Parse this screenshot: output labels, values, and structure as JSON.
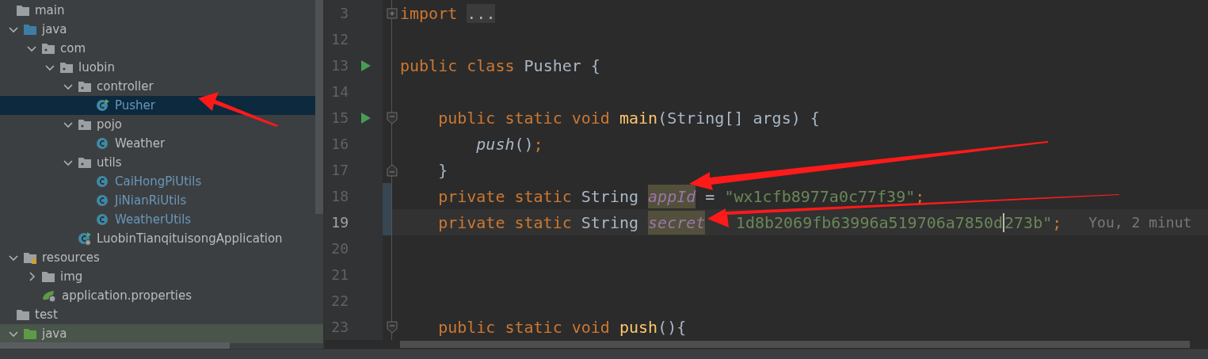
{
  "project_tree": [
    {
      "label": "main",
      "kind": "folder",
      "children": [
        {
          "label": "java",
          "kind": "source-folder",
          "expanded": true,
          "children": [
            {
              "label": "com",
              "kind": "package",
              "expanded": true,
              "children": [
                {
                  "label": "luobin",
                  "kind": "package",
                  "expanded": true,
                  "children": [
                    {
                      "label": "controller",
                      "kind": "package",
                      "expanded": true,
                      "children": [
                        {
                          "label": "Pusher",
                          "kind": "runnable-class",
                          "changed": true,
                          "selected": true
                        }
                      ]
                    },
                    {
                      "label": "pojo",
                      "kind": "package",
                      "expanded": true,
                      "children": [
                        {
                          "label": "Weather",
                          "kind": "class",
                          "changed": false,
                          "selected": false
                        }
                      ]
                    },
                    {
                      "label": "utils",
                      "kind": "package",
                      "expanded": true,
                      "children": [
                        {
                          "label": "CaiHongPiUtils",
                          "kind": "class",
                          "changed": true,
                          "selected": false
                        },
                        {
                          "label": "JiNianRiUtils",
                          "kind": "class",
                          "changed": true,
                          "selected": false
                        },
                        {
                          "label": "WeatherUtils",
                          "kind": "class",
                          "changed": true,
                          "selected": false
                        }
                      ]
                    },
                    {
                      "label": "LuobinTianqituisongApplication",
                      "kind": "spring-class",
                      "changed": false,
                      "selected": false
                    }
                  ]
                }
              ]
            }
          ]
        },
        {
          "label": "resources",
          "kind": "resources-folder",
          "expanded": true,
          "children": [
            {
              "label": "img",
              "kind": "folder",
              "expanded": false
            },
            {
              "label": "application.properties",
              "kind": "properties",
              "changed": false,
              "selected": false
            }
          ]
        }
      ]
    },
    {
      "label": "test",
      "kind": "folder",
      "children": [
        {
          "label": "java",
          "kind": "test-folder",
          "expanded": true
        }
      ]
    }
  ],
  "editor": {
    "lines": [
      {
        "number": "3",
        "current": false,
        "changed": false,
        "folded": true,
        "tokens": [
          {
            "text": "import ",
            "kind": "keyword"
          },
          {
            "text": "...",
            "kind": "folded"
          }
        ]
      },
      {
        "number": "12",
        "current": false,
        "changed": false
      },
      {
        "number": "13",
        "current": false,
        "changed": false,
        "run": true,
        "tokens": [
          {
            "text": "public class ",
            "kind": "keyword"
          },
          {
            "text": "Pusher {",
            "kind": "plain"
          }
        ]
      },
      {
        "number": "14",
        "current": false,
        "changed": false
      },
      {
        "number": "15",
        "current": false,
        "changed": false,
        "run": true,
        "fold_start": true,
        "tokens": [
          {
            "text": "    public static void ",
            "kind": "keyword"
          },
          {
            "text": "main",
            "kind": "method"
          },
          {
            "text": "(String[] args) {",
            "kind": "plain"
          }
        ]
      },
      {
        "number": "16",
        "current": false,
        "changed": false,
        "tokens": [
          {
            "text": "        push",
            "kind": "call"
          },
          {
            "text": "()",
            "kind": "plain"
          },
          {
            "text": ";",
            "kind": "keyword"
          }
        ]
      },
      {
        "number": "17",
        "current": false,
        "changed": false,
        "fold_end": true,
        "tokens": [
          {
            "text": "    }",
            "kind": "plain"
          }
        ]
      },
      {
        "number": "18",
        "current": false,
        "changed": true,
        "tokens": [
          {
            "text": "    private static ",
            "kind": "keyword"
          },
          {
            "text": "String ",
            "kind": "plain"
          },
          {
            "text": "appId",
            "kind": "field",
            "highlighted": true
          },
          {
            "text": " = ",
            "kind": "plain"
          },
          {
            "text": "\"wx1cfb8977a0c77f39\"",
            "kind": "string"
          },
          {
            "text": ";",
            "kind": "keyword"
          }
        ]
      },
      {
        "number": "19",
        "current": true,
        "changed": true,
        "tokens": [
          {
            "text": "    private static ",
            "kind": "keyword"
          },
          {
            "text": "String ",
            "kind": "plain"
          },
          {
            "text": "secret",
            "kind": "field",
            "highlighted": true
          },
          {
            "text": "1d8b2069fb63996a519706a7850d",
            "kind": "string",
            "gap_before": true,
            "caret_after": true
          },
          {
            "text": "273b\"",
            "kind": "string"
          },
          {
            "text": ";",
            "kind": "keyword"
          }
        ],
        "annotation": "You, 2 minut"
      },
      {
        "number": "20",
        "current": false,
        "changed": false
      },
      {
        "number": "21",
        "current": false,
        "changed": false
      },
      {
        "number": "22",
        "current": false,
        "changed": false
      },
      {
        "number": "23",
        "current": false,
        "changed": false,
        "fold_start": true,
        "tokens": [
          {
            "text": "    public static void ",
            "kind": "keyword"
          },
          {
            "text": "push",
            "kind": "method"
          },
          {
            "text": "(){",
            "kind": "plain"
          }
        ]
      }
    ]
  }
}
